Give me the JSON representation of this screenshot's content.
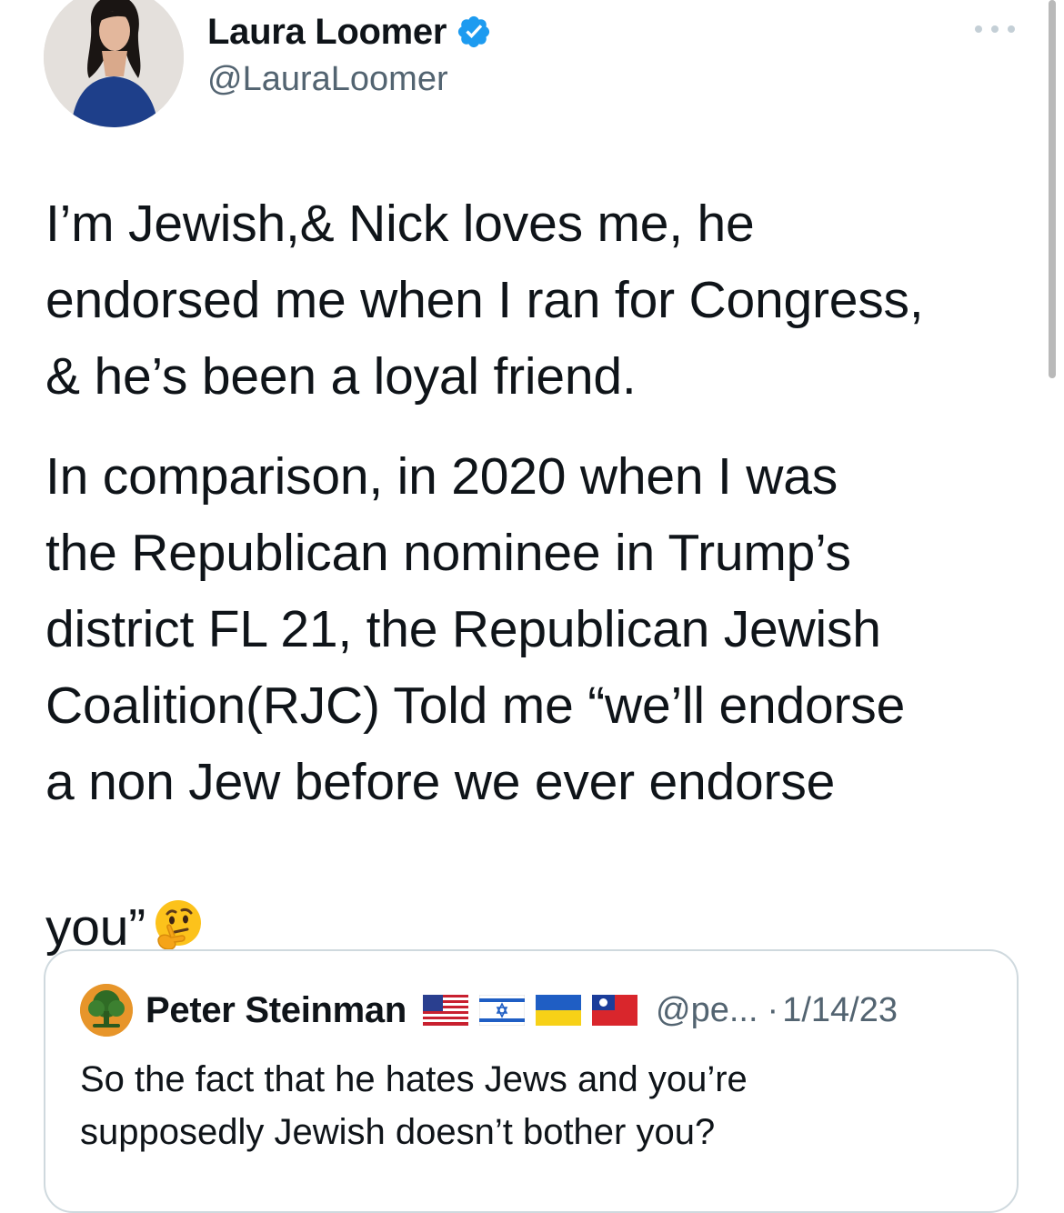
{
  "tweet": {
    "author": {
      "display_name": "Laura Loomer",
      "handle": "@LauraLoomer",
      "verified": true,
      "avatar_icon": "profile-photo"
    },
    "more_icon": "more-horizontal-icon",
    "paragraphs": [
      "I’m Jewish,& Nick loves me, he\nendorsed me when I ran for Congress,\n& he’s been a loyal friend.",
      "In comparison, in 2020 when I was\nthe Republican nominee in Trump’s\ndistrict FL 21, the Republican Jewish\nCoalition(RJC) Told me “we’ll endorse\na non Jew before we ever endorse\nyou”"
    ],
    "emoji": "thinking-face-emoji"
  },
  "quote": {
    "author": {
      "display_name": "Peter Steinman",
      "handle_truncated": "@pe...",
      "separator": "·",
      "date": "1/14/23",
      "avatar_icon": "tree-logo",
      "flags": [
        "us-flag",
        "israel-flag",
        "ukraine-flag",
        "taiwan-flag"
      ]
    },
    "text": "So the fact that he hates Jews and you’re\nsupposedly Jewish doesn’t bother you?"
  },
  "colors": {
    "text_primary": "#0f1419",
    "text_secondary": "#536471",
    "verified_blue": "#1d9bf0",
    "border": "#cfd9de"
  }
}
